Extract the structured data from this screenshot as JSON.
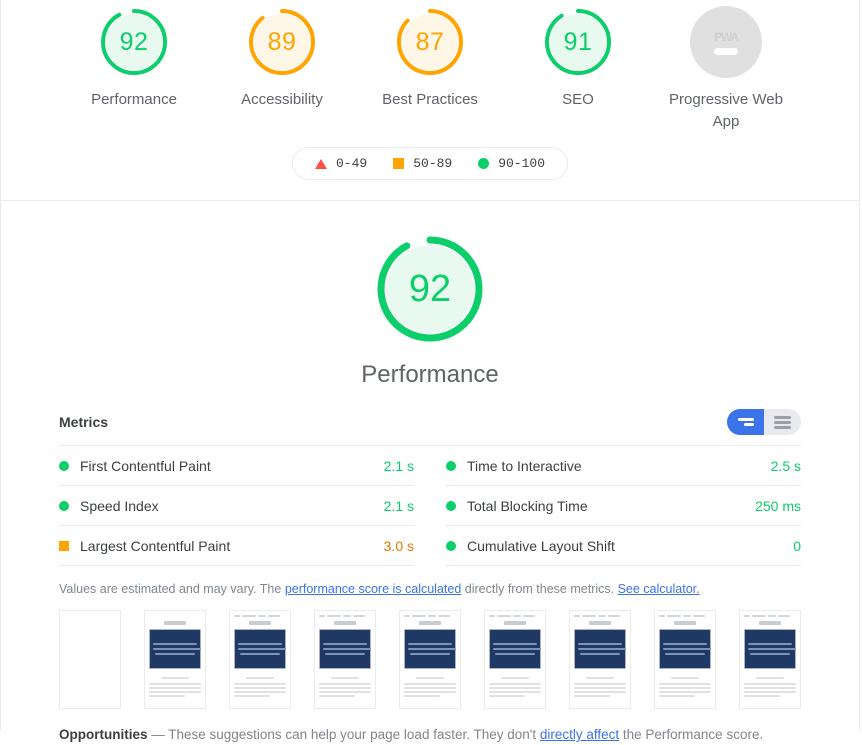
{
  "scores": [
    {
      "value": "92",
      "label": "Performance",
      "rating": "pass",
      "percent": 92
    },
    {
      "value": "89",
      "label": "Accessibility",
      "rating": "average",
      "percent": 89
    },
    {
      "value": "87",
      "label": "Best Practices",
      "rating": "average",
      "percent": 87
    },
    {
      "value": "91",
      "label": "SEO",
      "rating": "pass",
      "percent": 91
    },
    {
      "value": "PWA",
      "label": "Progressive Web App",
      "rating": "null",
      "percent": 0
    }
  ],
  "legend": [
    {
      "shape": "triangle-icon",
      "range": "0-49",
      "color": "#ff4e42"
    },
    {
      "shape": "square-icon",
      "range": "50-89",
      "color": "#ffa400"
    },
    {
      "shape": "circle-icon",
      "range": "90-100",
      "color": "#0cce6b"
    }
  ],
  "category": {
    "score": "92",
    "title": "Performance",
    "percent": 92,
    "color": "#0cce6b"
  },
  "metrics": {
    "heading": "Metrics",
    "toggle": {
      "chart_view_name": "bar-chart-toggle",
      "list_view_name": "list-toggle",
      "selected": "chart"
    },
    "left": [
      {
        "name": "First Contentful Paint",
        "value": "2.1 s",
        "rating": "pass"
      },
      {
        "name": "Speed Index",
        "value": "2.1 s",
        "rating": "pass"
      },
      {
        "name": "Largest Contentful Paint",
        "value": "3.0 s",
        "rating": "average"
      }
    ],
    "right": [
      {
        "name": "Time to Interactive",
        "value": "2.5 s",
        "rating": "pass"
      },
      {
        "name": "Total Blocking Time",
        "value": "250 ms",
        "rating": "pass"
      },
      {
        "name": "Cumulative Layout Shift",
        "value": "0",
        "rating": "pass"
      }
    ]
  },
  "disclaimer": {
    "pre": "Values are estimated and may vary. The ",
    "link1": "performance score is calculated",
    "mid": " directly from these metrics. ",
    "link2": "See calculator."
  },
  "filmstrip": {
    "frames": [
      "blank",
      "loaded",
      "loaded",
      "loaded",
      "loaded",
      "loaded",
      "loaded",
      "loaded",
      "loaded"
    ]
  },
  "opportunities": {
    "title": "Opportunities",
    "dash": " — ",
    "pre": "These suggestions can help your page load faster. They don't ",
    "link": "directly affect",
    "post": " the Performance score."
  },
  "colors": {
    "pass": "#0cce6b",
    "average": "#ffa400",
    "fail": "#ff4e42",
    "link": "#3b73e8",
    "null": "#e0e0e0"
  }
}
